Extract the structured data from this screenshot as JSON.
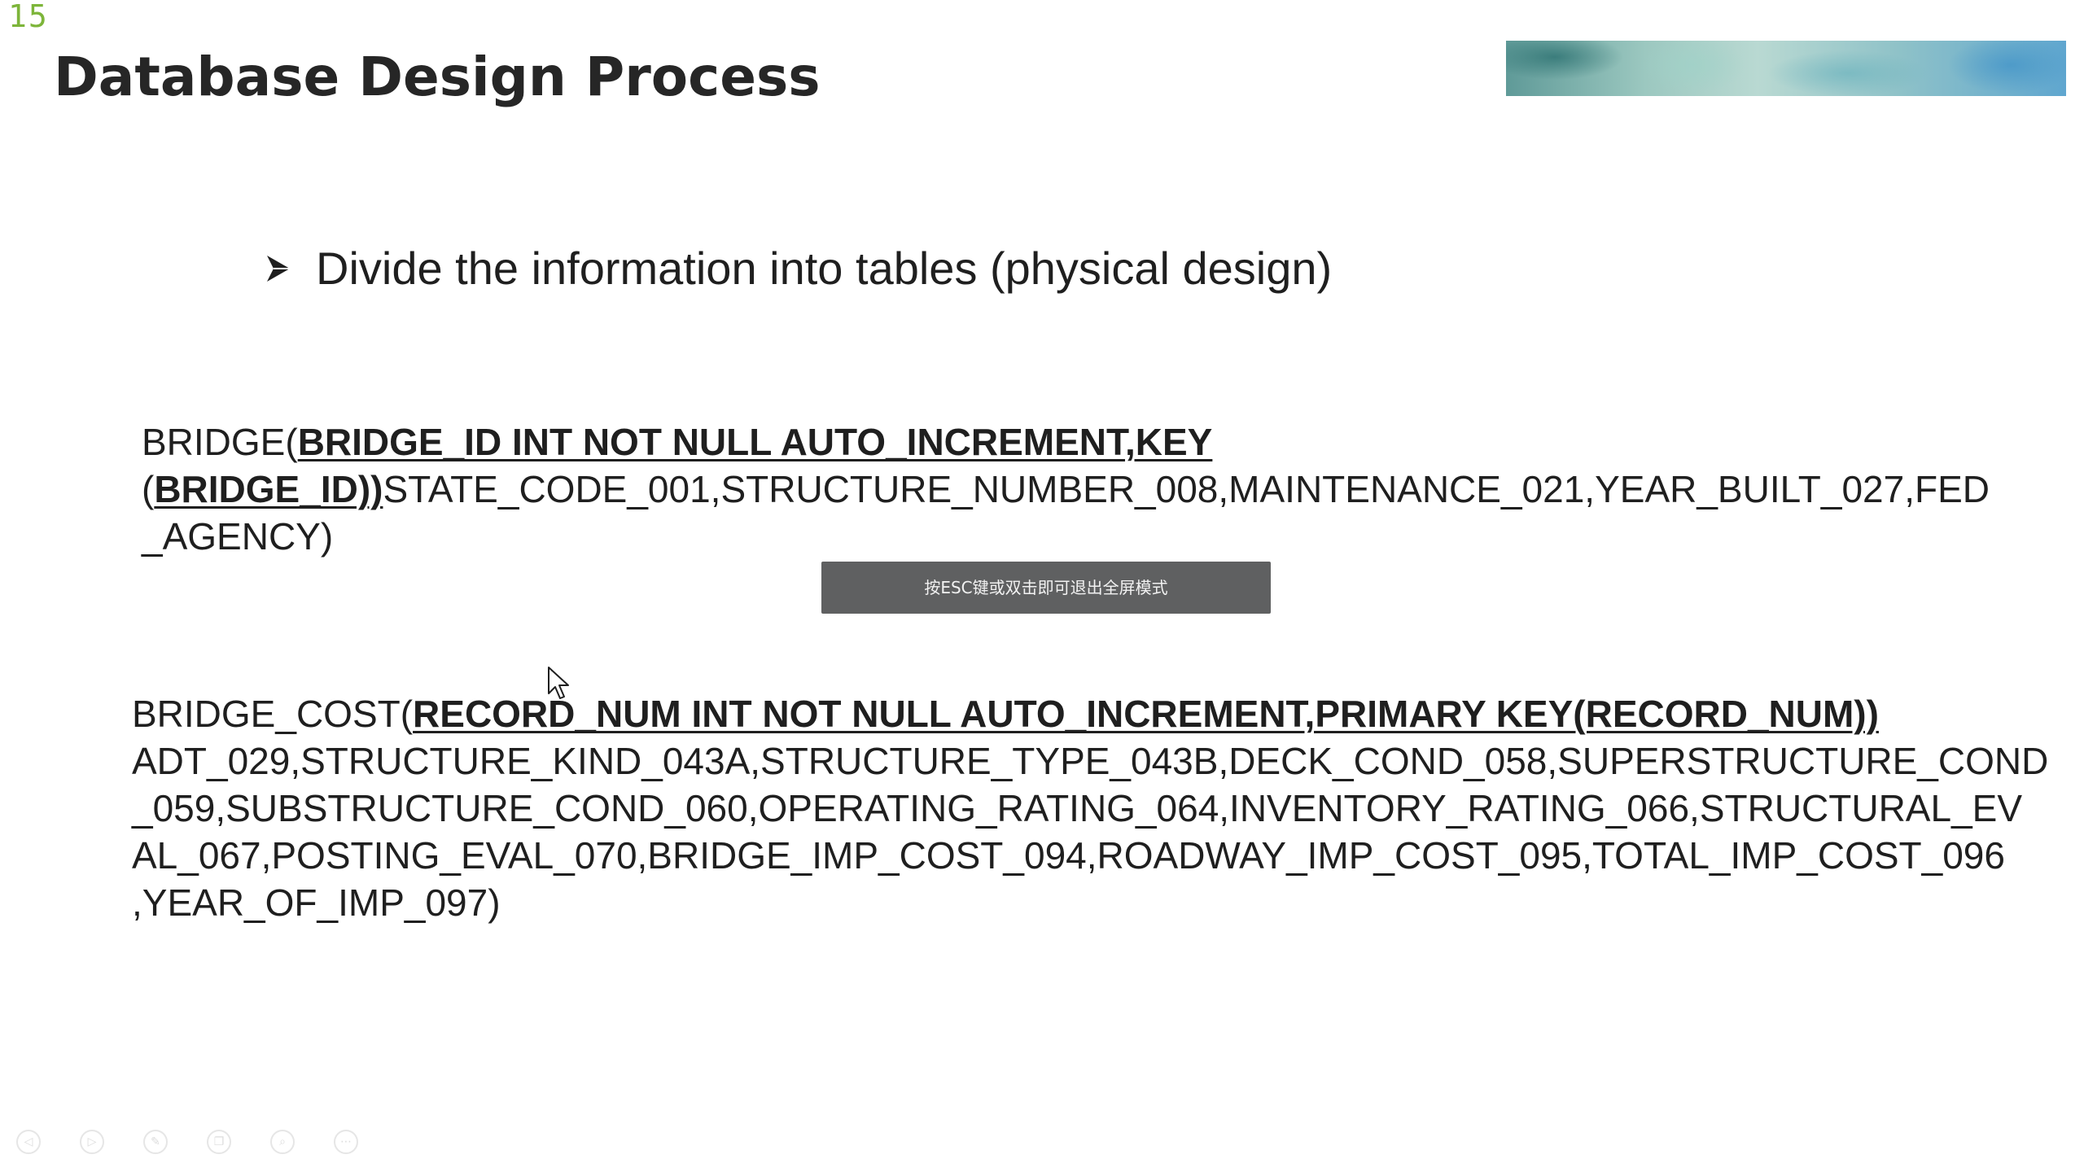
{
  "slide": {
    "number": "15",
    "title": "Database Design Process",
    "bullet": "Divide the information into tables (physical design)"
  },
  "bridge_table": {
    "lines": [
      [
        {
          "text": "BRIDGE(",
          "key": false
        },
        {
          "text": "BRIDGE_ID INT NOT NULL AUTO_INCREMENT,KEY",
          "key": true
        }
      ],
      [
        {
          "text": "(",
          "key": false
        },
        {
          "text": "BRIDGE_ID))",
          "key": true
        },
        {
          "text": "STATE_CODE_001,STRUCTURE_NUMBER_008,MAINTENANCE_021,YEAR_BUILT_027,FED",
          "key": false
        }
      ],
      [
        {
          "text": "_AGENCY)",
          "key": false
        }
      ]
    ]
  },
  "bridge_cost_table": {
    "lines": [
      [
        {
          "text": "BRIDGE_COST(",
          "key": false
        },
        {
          "text": "RECORD_NUM INT NOT NULL AUTO_INCREMENT,PRIMARY KEY(RECORD_NUM))",
          "key": true
        }
      ],
      [
        {
          "text": "ADT_029,STRUCTURE_KIND_043A,STRUCTURE_TYPE_043B,DECK_COND_058,SUPERSTRUCTURE_COND",
          "key": false
        }
      ],
      [
        {
          "text": "_059,SUBSTRUCTURE_COND_060,OPERATING_RATING_064,INVENTORY_RATING_066,STRUCTURAL_EV",
          "key": false
        }
      ],
      [
        {
          "text": "AL_067,POSTING_EVAL_070,BRIDGE_IMP_COST_094,ROADWAY_IMP_COST_095,TOTAL_IMP_COST_096",
          "key": false
        }
      ],
      [
        {
          "text": ",YEAR_OF_IMP_097)",
          "key": false
        }
      ]
    ]
  },
  "fullscreen_toast": {
    "text": "按ESC键或双击即可退出全屏模式"
  },
  "toolbar": {
    "buttons": [
      {
        "name": "previous",
        "icon": "arrow-left-icon",
        "glyph": "◁"
      },
      {
        "name": "next",
        "icon": "arrow-right-icon",
        "glyph": "▷"
      },
      {
        "name": "pen",
        "icon": "pen-icon",
        "glyph": "✎"
      },
      {
        "name": "slides",
        "icon": "slides-icon",
        "glyph": "❐"
      },
      {
        "name": "zoom",
        "icon": "zoom-icon",
        "glyph": "⌕"
      },
      {
        "name": "more",
        "icon": "more-icon",
        "glyph": "⋯"
      }
    ]
  },
  "colors": {
    "slide_number": "#7db53a",
    "toast_bg": "#5f6061"
  }
}
